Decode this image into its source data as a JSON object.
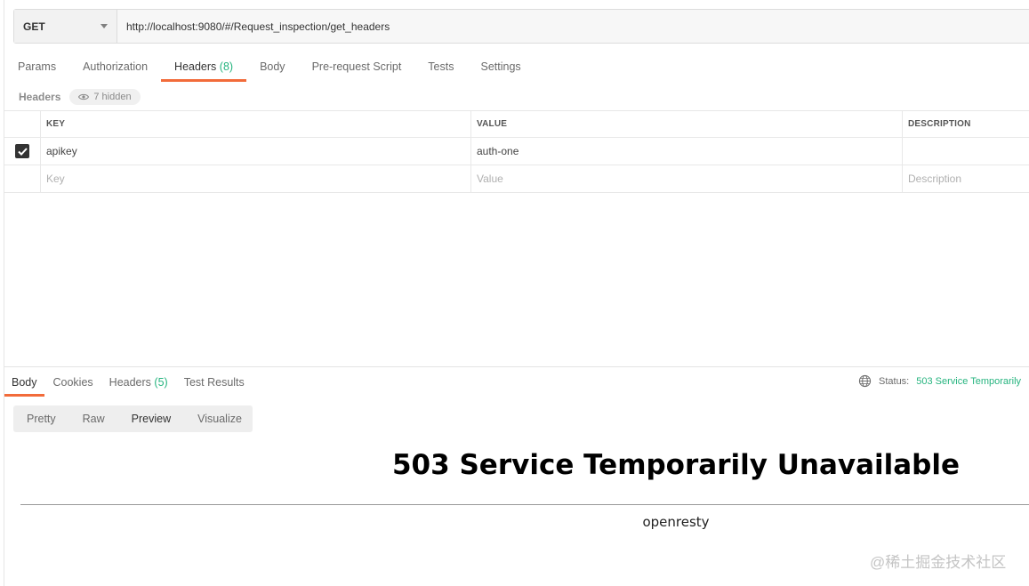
{
  "request": {
    "method": "GET",
    "url": "http://localhost:9080/#/Request_inspection/get_headers"
  },
  "request_tabs": [
    {
      "label": "Params",
      "count": ""
    },
    {
      "label": "Authorization",
      "count": ""
    },
    {
      "label": "Headers",
      "count": "(8)"
    },
    {
      "label": "Body",
      "count": ""
    },
    {
      "label": "Pre-request Script",
      "count": ""
    },
    {
      "label": "Tests",
      "count": ""
    },
    {
      "label": "Settings",
      "count": ""
    }
  ],
  "headers_section": {
    "label": "Headers",
    "hidden_text": "7 hidden"
  },
  "table": {
    "columns": {
      "key": "KEY",
      "value": "VALUE",
      "description": "DESCRIPTION"
    },
    "rows": [
      {
        "checked": true,
        "key": "apikey",
        "value": "auth-one",
        "description": ""
      }
    ],
    "placeholders": {
      "key": "Key",
      "value": "Value",
      "description": "Description"
    }
  },
  "response_tabs": [
    {
      "label": "Body",
      "count": ""
    },
    {
      "label": "Cookies",
      "count": ""
    },
    {
      "label": "Headers",
      "count": "(5)"
    },
    {
      "label": "Test Results",
      "count": ""
    }
  ],
  "status": {
    "label": "Status:",
    "value": "503 Service Temporarily"
  },
  "view_modes": [
    "Pretty",
    "Raw",
    "Preview",
    "Visualize"
  ],
  "preview": {
    "title": "503 Service Temporarily Unavailable",
    "server": "openresty"
  },
  "watermark": "@稀土掘金技术社区",
  "colors": {
    "accent": "#f26b3a",
    "success": "#26b47f"
  }
}
